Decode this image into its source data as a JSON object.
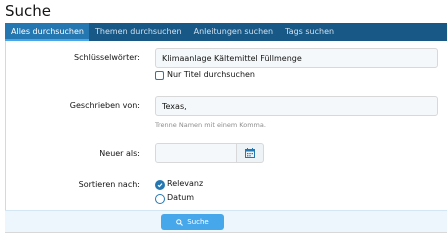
{
  "page": {
    "title": "Suche"
  },
  "tabs": [
    {
      "label": "Alles durchsuchen",
      "active": true
    },
    {
      "label": "Themen durchsuchen",
      "active": false
    },
    {
      "label": "Anleitungen suchen",
      "active": false
    },
    {
      "label": "Tags suchen",
      "active": false
    }
  ],
  "form": {
    "keywords": {
      "label": "Schlüsselwörter:",
      "value": "Klimaanlage Kältemittel Füllmenge"
    },
    "title_only": {
      "label": "Nur Titel durchsuchen",
      "checked": false
    },
    "author": {
      "label": "Geschrieben von:",
      "value": "Texas,",
      "hint": "Trenne Namen mit einem Komma."
    },
    "newer_than": {
      "label": "Neuer als:",
      "value": ""
    },
    "sort": {
      "label": "Sortieren nach:",
      "options": [
        {
          "label": "Relevanz",
          "selected": true
        },
        {
          "label": "Datum",
          "selected": false
        }
      ]
    }
  },
  "footer": {
    "search_button": "Suche"
  },
  "colors": {
    "tab_bar": "#185886",
    "tab_active": "#2577b1",
    "accent": "#47a7eb",
    "footer_bg": "#edf6fd"
  },
  "icons": {
    "calendar": "calendar-icon",
    "search": "search-icon"
  }
}
